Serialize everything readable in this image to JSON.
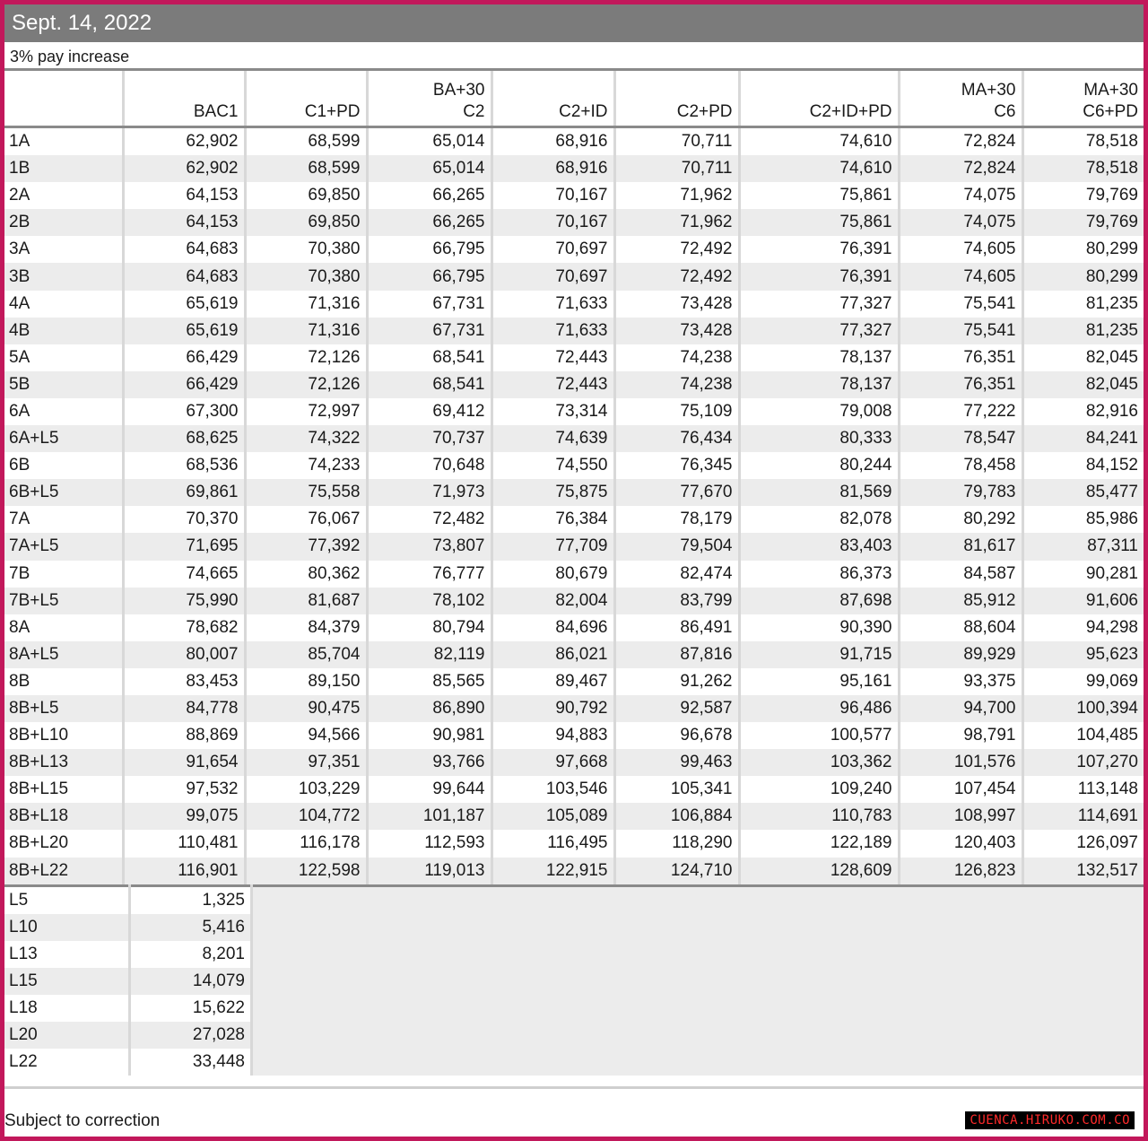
{
  "title": "Sept. 14, 2022",
  "subtitle": "3% pay increase",
  "columns": [
    "",
    "BAC1",
    "C1+PD",
    "BA+30\nC2",
    "C2+ID",
    "C2+PD",
    "C2+ID+PD",
    "MA+30\nC6",
    "MA+30\nC6+PD"
  ],
  "rows": [
    [
      "1A",
      "62,902",
      "68,599",
      "65,014",
      "68,916",
      "70,711",
      "74,610",
      "72,824",
      "78,518"
    ],
    [
      "1B",
      "62,902",
      "68,599",
      "65,014",
      "68,916",
      "70,711",
      "74,610",
      "72,824",
      "78,518"
    ],
    [
      "2A",
      "64,153",
      "69,850",
      "66,265",
      "70,167",
      "71,962",
      "75,861",
      "74,075",
      "79,769"
    ],
    [
      "2B",
      "64,153",
      "69,850",
      "66,265",
      "70,167",
      "71,962",
      "75,861",
      "74,075",
      "79,769"
    ],
    [
      "3A",
      "64,683",
      "70,380",
      "66,795",
      "70,697",
      "72,492",
      "76,391",
      "74,605",
      "80,299"
    ],
    [
      "3B",
      "64,683",
      "70,380",
      "66,795",
      "70,697",
      "72,492",
      "76,391",
      "74,605",
      "80,299"
    ],
    [
      "4A",
      "65,619",
      "71,316",
      "67,731",
      "71,633",
      "73,428",
      "77,327",
      "75,541",
      "81,235"
    ],
    [
      "4B",
      "65,619",
      "71,316",
      "67,731",
      "71,633",
      "73,428",
      "77,327",
      "75,541",
      "81,235"
    ],
    [
      "5A",
      "66,429",
      "72,126",
      "68,541",
      "72,443",
      "74,238",
      "78,137",
      "76,351",
      "82,045"
    ],
    [
      "5B",
      "66,429",
      "72,126",
      "68,541",
      "72,443",
      "74,238",
      "78,137",
      "76,351",
      "82,045"
    ],
    [
      "6A",
      "67,300",
      "72,997",
      "69,412",
      "73,314",
      "75,109",
      "79,008",
      "77,222",
      "82,916"
    ],
    [
      "6A+L5",
      "68,625",
      "74,322",
      "70,737",
      "74,639",
      "76,434",
      "80,333",
      "78,547",
      "84,241"
    ],
    [
      "6B",
      "68,536",
      "74,233",
      "70,648",
      "74,550",
      "76,345",
      "80,244",
      "78,458",
      "84,152"
    ],
    [
      "6B+L5",
      "69,861",
      "75,558",
      "71,973",
      "75,875",
      "77,670",
      "81,569",
      "79,783",
      "85,477"
    ],
    [
      "7A",
      "70,370",
      "76,067",
      "72,482",
      "76,384",
      "78,179",
      "82,078",
      "80,292",
      "85,986"
    ],
    [
      "7A+L5",
      "71,695",
      "77,392",
      "73,807",
      "77,709",
      "79,504",
      "83,403",
      "81,617",
      "87,311"
    ],
    [
      "7B",
      "74,665",
      "80,362",
      "76,777",
      "80,679",
      "82,474",
      "86,373",
      "84,587",
      "90,281"
    ],
    [
      "7B+L5",
      "75,990",
      "81,687",
      "78,102",
      "82,004",
      "83,799",
      "87,698",
      "85,912",
      "91,606"
    ],
    [
      "8A",
      "78,682",
      "84,379",
      "80,794",
      "84,696",
      "86,491",
      "90,390",
      "88,604",
      "94,298"
    ],
    [
      "8A+L5",
      "80,007",
      "85,704",
      "82,119",
      "86,021",
      "87,816",
      "91,715",
      "89,929",
      "95,623"
    ],
    [
      "8B",
      "83,453",
      "89,150",
      "85,565",
      "89,467",
      "91,262",
      "95,161",
      "93,375",
      "99,069"
    ],
    [
      "8B+L5",
      "84,778",
      "90,475",
      "86,890",
      "90,792",
      "92,587",
      "96,486",
      "94,700",
      "100,394"
    ],
    [
      "8B+L10",
      "88,869",
      "94,566",
      "90,981",
      "94,883",
      "96,678",
      "100,577",
      "98,791",
      "104,485"
    ],
    [
      "8B+L13",
      "91,654",
      "97,351",
      "93,766",
      "97,668",
      "99,463",
      "103,362",
      "101,576",
      "107,270"
    ],
    [
      "8B+L15",
      "97,532",
      "103,229",
      "99,644",
      "103,546",
      "105,341",
      "109,240",
      "107,454",
      "113,148"
    ],
    [
      "8B+L18",
      "99,075",
      "104,772",
      "101,187",
      "105,089",
      "106,884",
      "110,783",
      "108,997",
      "114,691"
    ],
    [
      "8B+L20",
      "110,481",
      "116,178",
      "112,593",
      "116,495",
      "118,290",
      "122,189",
      "120,403",
      "126,097"
    ],
    [
      "8B+L22",
      "116,901",
      "122,598",
      "119,013",
      "122,915",
      "124,710",
      "128,609",
      "126,823",
      "132,517"
    ]
  ],
  "longevity": [
    [
      "L5",
      "1,325"
    ],
    [
      "L10",
      "5,416"
    ],
    [
      "L13",
      "8,201"
    ],
    [
      "L15",
      "14,079"
    ],
    [
      "L18",
      "15,622"
    ],
    [
      "L20",
      "27,028"
    ],
    [
      "L22",
      "33,448"
    ]
  ],
  "footer_note": "Subject to correction",
  "watermark": "CUENCA.HIRUKO.COM.CO"
}
